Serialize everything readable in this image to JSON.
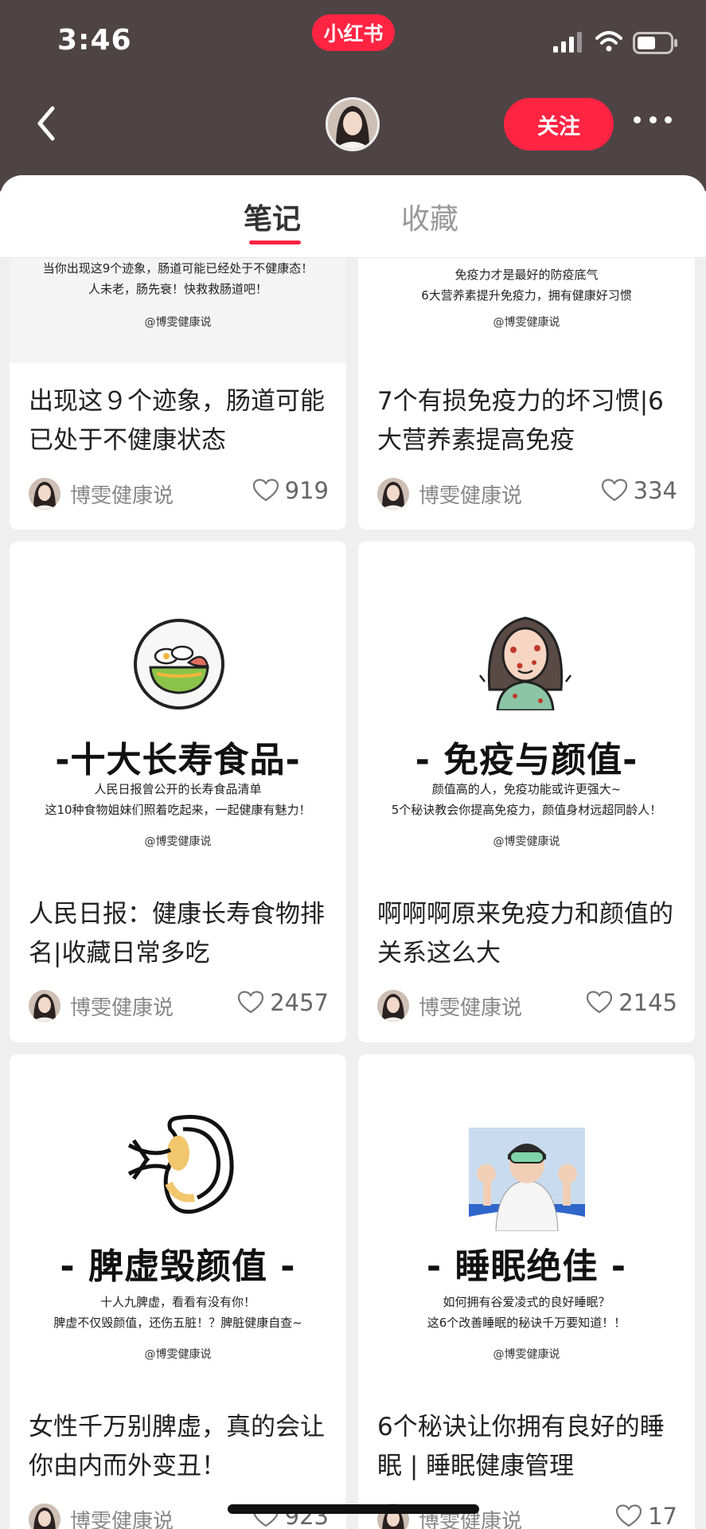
{
  "status_bar": {
    "time": "3:46",
    "app_badge": "小红书"
  },
  "header": {
    "follow_label": "关注"
  },
  "tabs": {
    "notes": "笔记",
    "favorites": "收藏"
  },
  "cards": [
    {
      "cover": {
        "lines": [
          "当你出现这9个迹象，肠道可能已经处于不健康态！",
          "人未老，肠先衰！快救救肠道吧！"
        ],
        "handle": "@博雯健康说"
      },
      "title": "出现这９个迹象，肠道可能已处于不健康状态",
      "author": "博雯健康说",
      "likes": "919"
    },
    {
      "cover": {
        "lines": [
          "免疫力才是最好的防疫底气",
          "6大营养素提升免疫力，拥有健康好习惯"
        ],
        "handle": "@博雯健康说"
      },
      "title": "7个有损免疫力的坏习惯|6大营养素提高免疫",
      "author": "博雯健康说",
      "likes": "334"
    },
    {
      "cover": {
        "big": "-十大长寿食品-",
        "lines": [
          "人民日报曾公开的长寿食品清单",
          "这10种食物姐妹们照着吃起来，一起健康有魅力！"
        ],
        "handle": "@博雯健康说",
        "icon": "food-bowl-icon"
      },
      "title": "人民日报：健康长寿食物排名|收藏日常多吃",
      "author": "博雯健康说",
      "likes": "2457"
    },
    {
      "cover": {
        "big": "- 免疫与颜值-",
        "lines": [
          "颜值高的人，免疫功能或许更强大~",
          "5个秘诀教会你提高免疫力，颜值身材远超同龄人！"
        ],
        "handle": "@博雯健康说",
        "icon": "sick-girl-icon"
      },
      "title": "啊啊啊原来免疫力和颜值的关系这么大",
      "author": "博雯健康说",
      "likes": "2145"
    },
    {
      "cover": {
        "big": "- 脾虚毁颜值 -",
        "lines": [
          "十人九脾虚，看看有没有你！",
          "脾虚不仅毁颜值，还伤五脏！？脾脏健康自查~"
        ],
        "handle": "@博雯健康说",
        "icon": "spleen-icon"
      },
      "title": "女性千万别脾虚，真的会让你由内而外变丑！",
      "author": "博雯健康说",
      "likes": "923"
    },
    {
      "cover": {
        "big": "- 睡眠绝佳 -",
        "lines": [
          "如何拥有谷爱凌式的良好睡眠？",
          "这6个改善睡眠的秘诀千万要知道！！"
        ],
        "handle": "@博雯健康说",
        "icon": "skier-photo"
      },
      "title": "6个秘诀让你拥有良好的睡眠 | 睡眠健康管理",
      "author": "博雯健康说",
      "likes": "17"
    }
  ],
  "colors": {
    "brand": "#ff2442",
    "header_bg": "#4e4345",
    "page_bg": "#f0efef"
  }
}
